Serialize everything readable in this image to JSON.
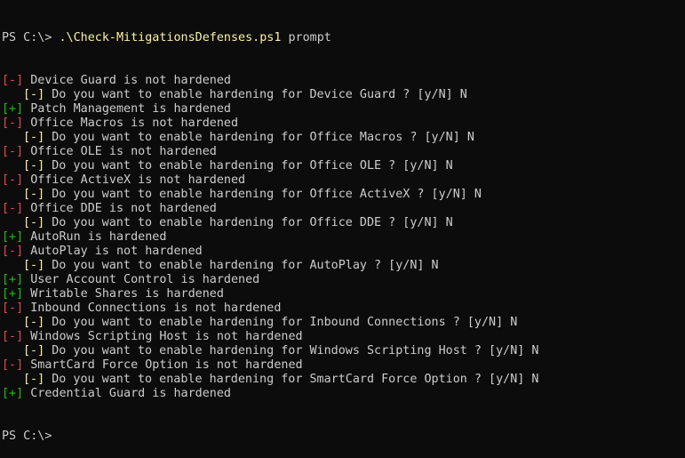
{
  "colors": {
    "background": "#0c0c0c",
    "foreground": "#cccccc",
    "fail_marker": "#e74856",
    "pass_marker": "#16c60c",
    "question_marker": "#f9f1a5",
    "script_name": "#f9f1a5"
  },
  "command": {
    "prompt": "PS C:\\> ",
    "script": ".\\Check-MitigationsDefenses.ps1",
    "argument": " prompt"
  },
  "lines": [
    {
      "type": "fail",
      "marker": "[-]",
      "text": " Device Guard is not hardened"
    },
    {
      "type": "question",
      "marker": "[-]",
      "text": " Do you want to enable hardening for Device Guard ? [y/N] N"
    },
    {
      "type": "pass",
      "marker": "[+]",
      "text": " Patch Management is hardened"
    },
    {
      "type": "fail",
      "marker": "[-]",
      "text": " Office Macros is not hardened"
    },
    {
      "type": "question",
      "marker": "[-]",
      "text": " Do you want to enable hardening for Office Macros ? [y/N] N"
    },
    {
      "type": "fail",
      "marker": "[-]",
      "text": " Office OLE is not hardened"
    },
    {
      "type": "question",
      "marker": "[-]",
      "text": " Do you want to enable hardening for Office OLE ? [y/N] N"
    },
    {
      "type": "fail",
      "marker": "[-]",
      "text": " Office ActiveX is not hardened"
    },
    {
      "type": "question",
      "marker": "[-]",
      "text": " Do you want to enable hardening for Office ActiveX ? [y/N] N"
    },
    {
      "type": "fail",
      "marker": "[-]",
      "text": " Office DDE is not hardened"
    },
    {
      "type": "question",
      "marker": "[-]",
      "text": " Do you want to enable hardening for Office DDE ? [y/N] N"
    },
    {
      "type": "pass",
      "marker": "[+]",
      "text": " AutoRun is hardened"
    },
    {
      "type": "fail",
      "marker": "[-]",
      "text": " AutoPlay is not hardened"
    },
    {
      "type": "question",
      "marker": "[-]",
      "text": " Do you want to enable hardening for AutoPlay ? [y/N] N"
    },
    {
      "type": "pass",
      "marker": "[+]",
      "text": " User Account Control is hardened"
    },
    {
      "type": "pass",
      "marker": "[+]",
      "text": " Writable Shares is hardened"
    },
    {
      "type": "fail",
      "marker": "[-]",
      "text": " Inbound Connections is not hardened"
    },
    {
      "type": "question",
      "marker": "[-]",
      "text": " Do you want to enable hardening for Inbound Connections ? [y/N] N"
    },
    {
      "type": "fail",
      "marker": "[-]",
      "text": " Windows Scripting Host is not hardened"
    },
    {
      "type": "question",
      "marker": "[-]",
      "text": " Do you want to enable hardening for Windows Scripting Host ? [y/N] N"
    },
    {
      "type": "fail",
      "marker": "[-]",
      "text": " SmartCard Force Option is not hardened"
    },
    {
      "type": "question",
      "marker": "[-]",
      "text": " Do you want to enable hardening for SmartCard Force Option ? [y/N] N"
    },
    {
      "type": "pass",
      "marker": "[+]",
      "text": " Credential Guard is hardened"
    }
  ],
  "final_prompt": "PS C:\\>"
}
